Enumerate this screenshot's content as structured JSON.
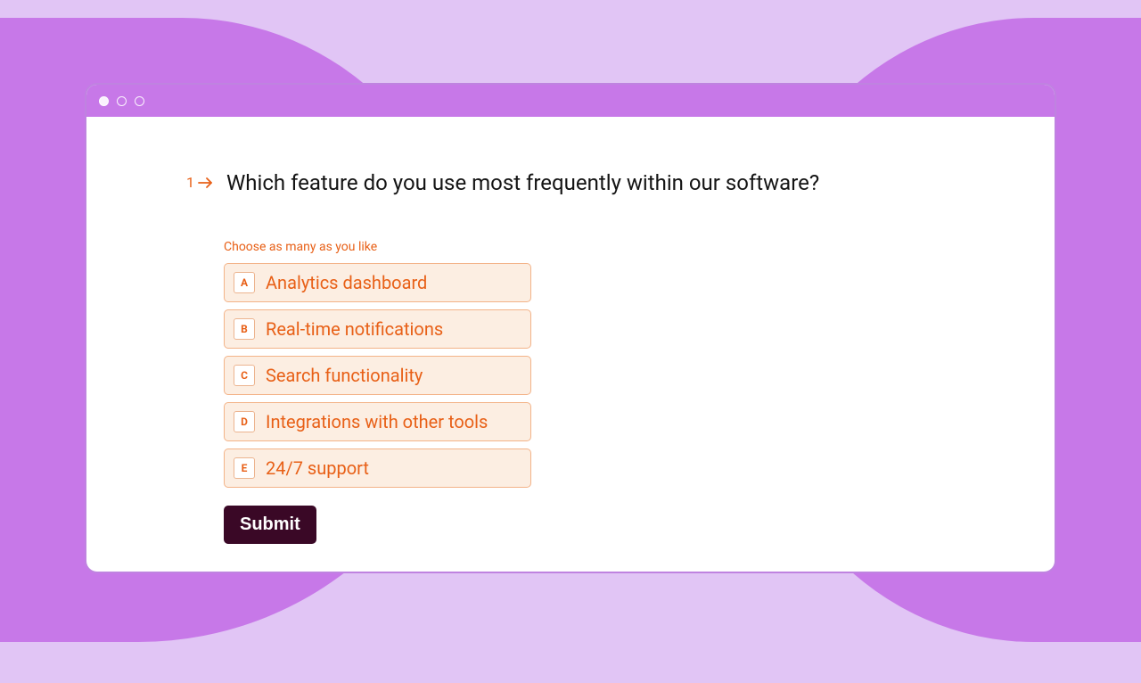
{
  "question": {
    "number": "1",
    "text": "Which feature do you use most frequently within our software?",
    "instructions": "Choose as many as you like"
  },
  "options": [
    {
      "key": "A",
      "label": "Analytics dashboard"
    },
    {
      "key": "B",
      "label": "Real-time notifications"
    },
    {
      "key": "C",
      "label": "Search functionality"
    },
    {
      "key": "D",
      "label": "Integrations with other tools"
    },
    {
      "key": "E",
      "label": "24/7 support"
    }
  ],
  "submit_label": "Submit"
}
